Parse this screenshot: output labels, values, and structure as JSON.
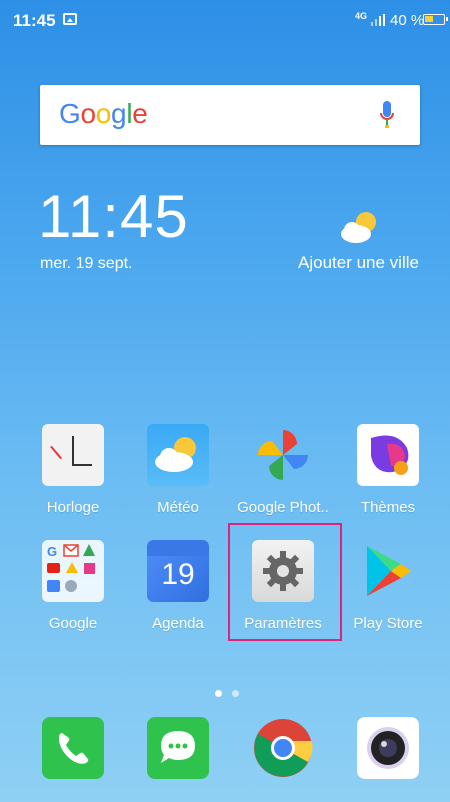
{
  "status_bar": {
    "time": "11:45",
    "network": "4G",
    "battery_percent": "40 %"
  },
  "search": {
    "logo_text": "Google",
    "mic_icon": "mic-icon"
  },
  "clock": {
    "time": "11:45",
    "date": "mer. 19 sept."
  },
  "weather": {
    "icon": "partly-cloudy-icon",
    "label": "Ajouter une ville"
  },
  "apps": [
    {
      "label": "Horloge",
      "icon": "clock-icon"
    },
    {
      "label": "Météo",
      "icon": "weather-icon"
    },
    {
      "label": "Google Phot..",
      "icon": "photos-pinwheel-icon"
    },
    {
      "label": "Thèmes",
      "icon": "themes-icon"
    },
    {
      "label": "Google",
      "icon": "google-folder-icon"
    },
    {
      "label": "Agenda",
      "icon": "calendar-icon",
      "day": "19"
    },
    {
      "label": "Paramètres",
      "icon": "settings-gear-icon",
      "highlighted": true
    },
    {
      "label": "Play Store",
      "icon": "play-store-icon"
    }
  ],
  "page_indicator": {
    "pages": 2,
    "current": 1
  },
  "dock": [
    {
      "icon": "phone-icon"
    },
    {
      "icon": "messages-icon"
    },
    {
      "icon": "chrome-icon"
    },
    {
      "icon": "camera-icon"
    }
  ],
  "colors": {
    "highlight": "#e0237a",
    "battery": "#f5d23a"
  }
}
